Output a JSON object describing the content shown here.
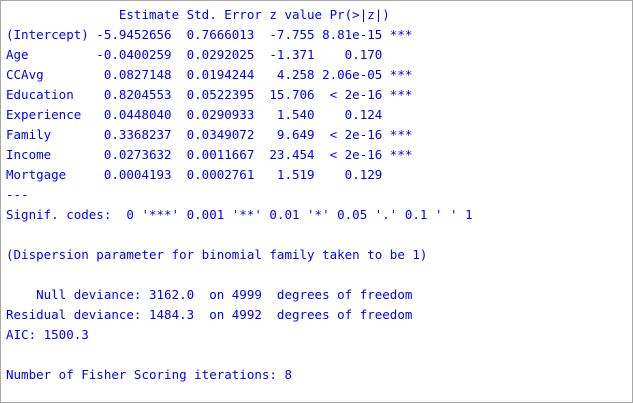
{
  "console": {
    "lines": [
      "               Estimate Std. Error z value Pr(>|z|)    ",
      "(Intercept) -5.9452656  0.7666013  -7.755 8.81e-15 ***",
      "Age         -0.0400259  0.0292025  -1.371    0.170    ",
      "CCAvg        0.0827148  0.0194244   4.258 2.06e-05 ***",
      "Education    0.8204553  0.0522395  15.706  < 2e-16 ***",
      "Experience   0.0448040  0.0290933   1.540    0.124    ",
      "Family       0.3368237  0.0349072   9.649  < 2e-16 ***",
      "Income       0.0273632  0.0011667  23.454  < 2e-16 ***",
      "Mortgage     0.0004193  0.0002761   1.519    0.129    ",
      "---",
      "Signif. codes:  0 '***' 0.001 '**' 0.01 '*' 0.05 '.' 0.1 ' ' 1",
      "",
      "(Dispersion parameter for binomial family taken to be 1)",
      "",
      "    Null deviance: 3162.0  on 4999  degrees of freedom",
      "Residual deviance: 1484.3  on 4992  degrees of freedom",
      "AIC: 1500.3",
      "",
      "Number of Fisher Scoring iterations: 8"
    ]
  }
}
